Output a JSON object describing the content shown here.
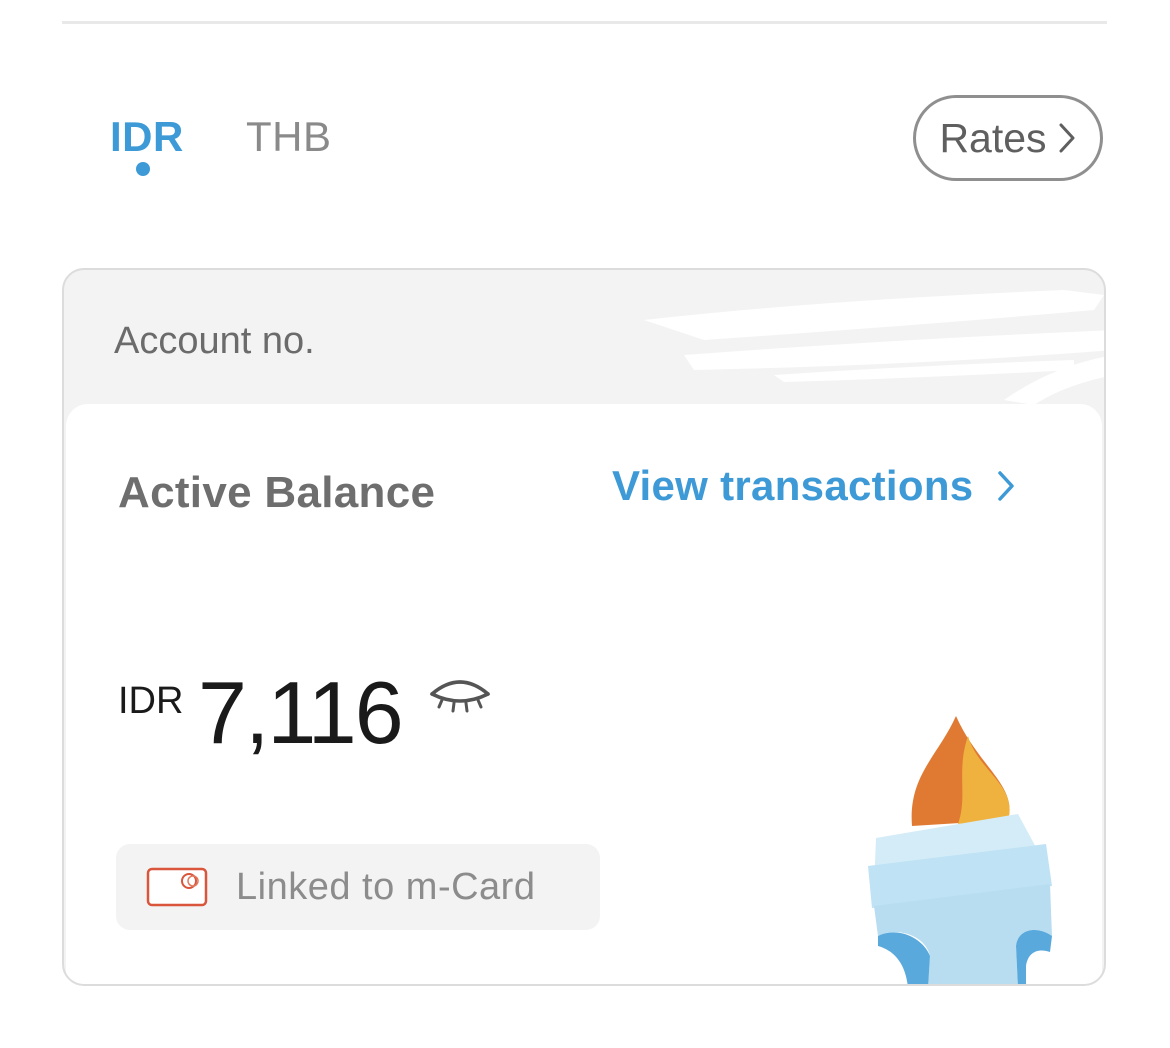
{
  "tabs": [
    {
      "label": "IDR",
      "active": true
    },
    {
      "label": "THB",
      "active": false
    }
  ],
  "rates_button": {
    "label": "Rates"
  },
  "account": {
    "label": "Account no."
  },
  "balance": {
    "title": "Active Balance",
    "view_transactions": "View transactions",
    "currency": "IDR",
    "amount": "7,116"
  },
  "linked": {
    "label": "Linked to m-Card"
  },
  "colors": {
    "accent": "#3d9ad6",
    "card_bg": "#f3f3f3",
    "text_dark": "#1a1a1a",
    "card_icon": "#d9553b"
  },
  "icons": [
    "chevron-right-icon",
    "eye-closed-icon",
    "card-icon",
    "torch-illustration"
  ]
}
